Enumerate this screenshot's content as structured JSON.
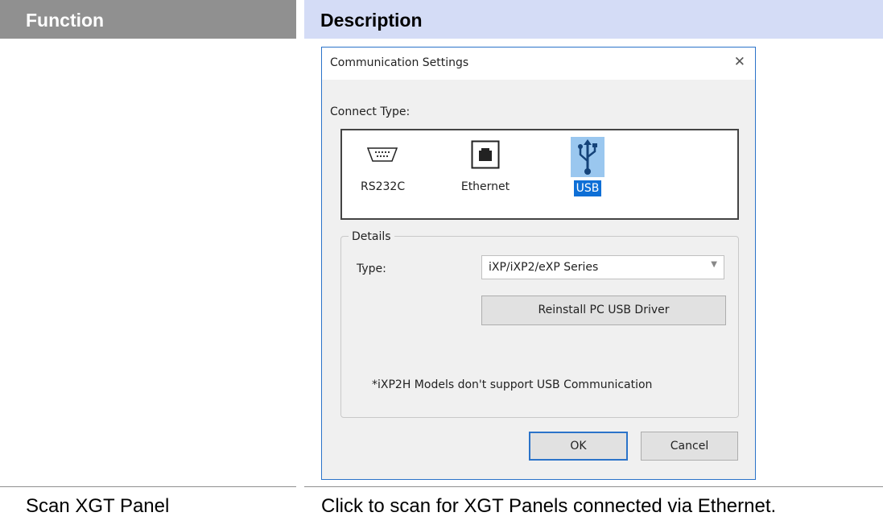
{
  "table": {
    "header_function": "Function",
    "header_description": "Description",
    "row_function": "Scan XGT Panel",
    "row_description": "Click to scan for XGT Panels connected via Ethernet."
  },
  "dialog": {
    "title": "Communication Settings",
    "close_glyph": "✕",
    "connect_type_label": "Connect Type:",
    "connect_types": [
      "RS232C",
      "Ethernet",
      "USB"
    ],
    "selected_connect_type": "USB",
    "details_label": "Details",
    "type_label": "Type:",
    "type_value": "iXP/iXP2/eXP Series",
    "reinstall_button": "Reinstall PC USB Driver",
    "note": "*iXP2H Models don't support USB Communication",
    "ok_button": "OK",
    "cancel_button": "Cancel"
  },
  "icons": {
    "rs232c": "serial-port-icon",
    "ethernet": "ethernet-port-icon",
    "usb": "usb-icon"
  },
  "colors": {
    "header_function_bg": "#909090",
    "header_description_bg": "#d4dcf6",
    "dialog_accent": "#2b73c9",
    "selection": "#0e6fd6"
  }
}
